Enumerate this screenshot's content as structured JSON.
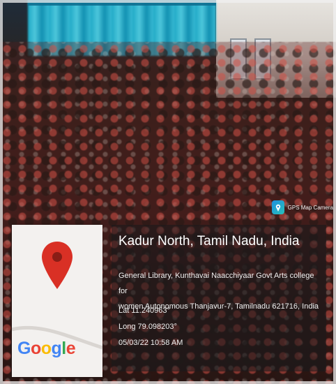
{
  "gps_badge": {
    "label": "GPS Map Camera",
    "icon": "gps-map-camera-icon"
  },
  "map": {
    "logo": "Google",
    "pin_icon": "map-pin-icon",
    "pin_color": "#d93025"
  },
  "location": {
    "place": "Kadur North, Tamil Nadu, India",
    "address_line1": "General Library, Kunthavai Naacchiyaar Govt Arts college for",
    "address_line2": "women Autonomous Thanjavur-7, Tamilnadu 621716, India",
    "lat": "Lat 11.240963°",
    "long": "Long 79.098203°",
    "datetime": "05/03/22 10:58 AM"
  }
}
